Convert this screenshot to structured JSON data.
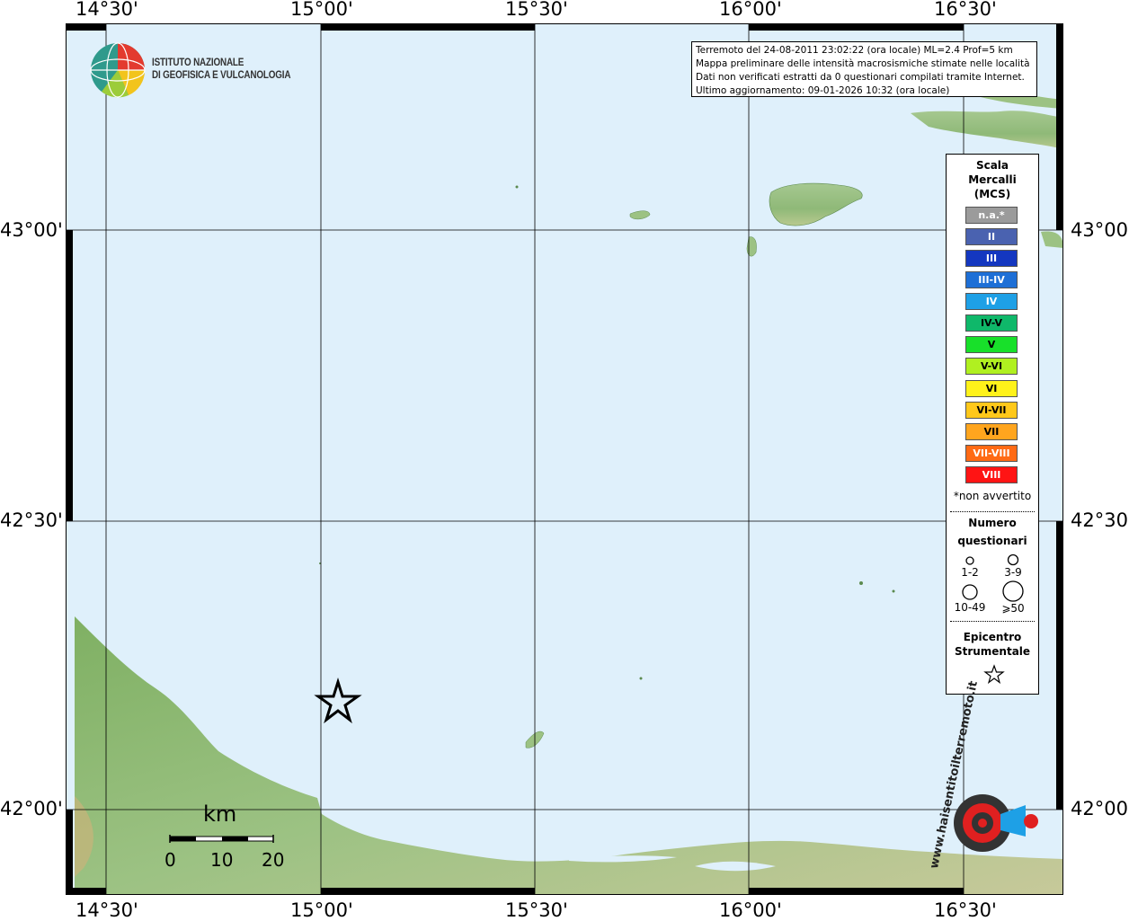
{
  "map": {
    "lon_ticks": [
      "14°30'",
      "15°00'",
      "15°30'",
      "16°00'",
      "16°30'"
    ],
    "lat_ticks": [
      "43°00'",
      "42°30'",
      "42°00'"
    ],
    "colors": {
      "sea": "#dff0fb",
      "land_low": "#7aab5e",
      "land_mid": "#9fc289",
      "land_high": "#d9c79c",
      "grid": "#000000"
    }
  },
  "logo": {
    "line1": "ISTITUTO NAZIONALE",
    "line2": "DI GEOFISICA E VULCANOLOGIA"
  },
  "info": {
    "line1": "Terremoto del 24-08-2011 23:02:22 (ora locale) ML=2.4 Prof=5 km",
    "line2": "Mappa preliminare delle intensità macrosismiche stimate nelle località",
    "line3": "Dati non verificati estratti da 0 questionari compilati tramite Internet.",
    "line4": "Ultimo aggiornamento: 09-01-2026 10:32 (ora locale)"
  },
  "legend": {
    "title1": "Scala",
    "title2": "Mercalli",
    "title3": "(MCS)",
    "classes": [
      {
        "label": "n.a.*",
        "color": "#9b9b9b"
      },
      {
        "label": "II",
        "color": "#4a62b0"
      },
      {
        "label": "III",
        "color": "#1437c0"
      },
      {
        "label": "III-IV",
        "color": "#1e6fd6"
      },
      {
        "label": "IV",
        "color": "#1ea0e6"
      },
      {
        "label": "IV-V",
        "color": "#0fb86a"
      },
      {
        "label": "V",
        "color": "#18e02a"
      },
      {
        "label": "V-VI",
        "color": "#b0f020"
      },
      {
        "label": "VI",
        "color": "#fff21a"
      },
      {
        "label": "VI-VII",
        "color": "#ffc81a"
      },
      {
        "label": "VII",
        "color": "#ffa51e"
      },
      {
        "label": "VII-VIII",
        "color": "#ff6a14"
      },
      {
        "label": "VIII",
        "color": "#ff1414"
      }
    ],
    "note": "*non avvertito",
    "count_title1": "Numero",
    "count_title2": "questionari",
    "count_classes": [
      "1-2",
      "3-9",
      "10-49",
      "⩾50"
    ],
    "epicenter_title1": "Epicentro",
    "epicenter_title2": "Strumentale"
  },
  "scale_bar": {
    "unit": "km",
    "labels": [
      "0",
      "10",
      "20"
    ]
  },
  "watermark": {
    "text": "www.haisentitoilterremoto.it"
  }
}
